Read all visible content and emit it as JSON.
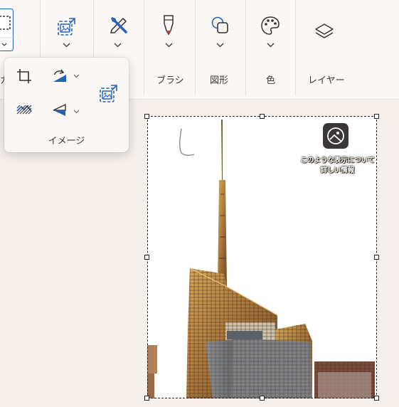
{
  "ribbon": {
    "groups": [
      {
        "label": "ブラシ"
      },
      {
        "label": "図形"
      },
      {
        "label": "色"
      },
      {
        "label": "レイヤー"
      }
    ],
    "partial_left_label": "カ",
    "partial_image_label": "ー"
  },
  "image_flyout": {
    "label": "イメージ",
    "tools": [
      {
        "name": "crop",
        "icon": "crop-icon"
      },
      {
        "name": "rotate",
        "icon": "rotate-icon",
        "has_dropdown": true
      },
      {
        "name": "resize",
        "icon": "resize-image-icon"
      },
      {
        "name": "remove-background",
        "icon": "remove-background-icon"
      },
      {
        "name": "flip",
        "icon": "flip-icon",
        "has_dropdown": true
      }
    ]
  },
  "canvas": {
    "watermark_lines": [
      "このような表示について",
      "詳しい情報"
    ],
    "watermark_icon": "image-info-icon"
  },
  "colors": {
    "accent": "#2563b8",
    "ribbon_bg": "#faf7f4",
    "canvas_bg": "#f6f0ec"
  }
}
